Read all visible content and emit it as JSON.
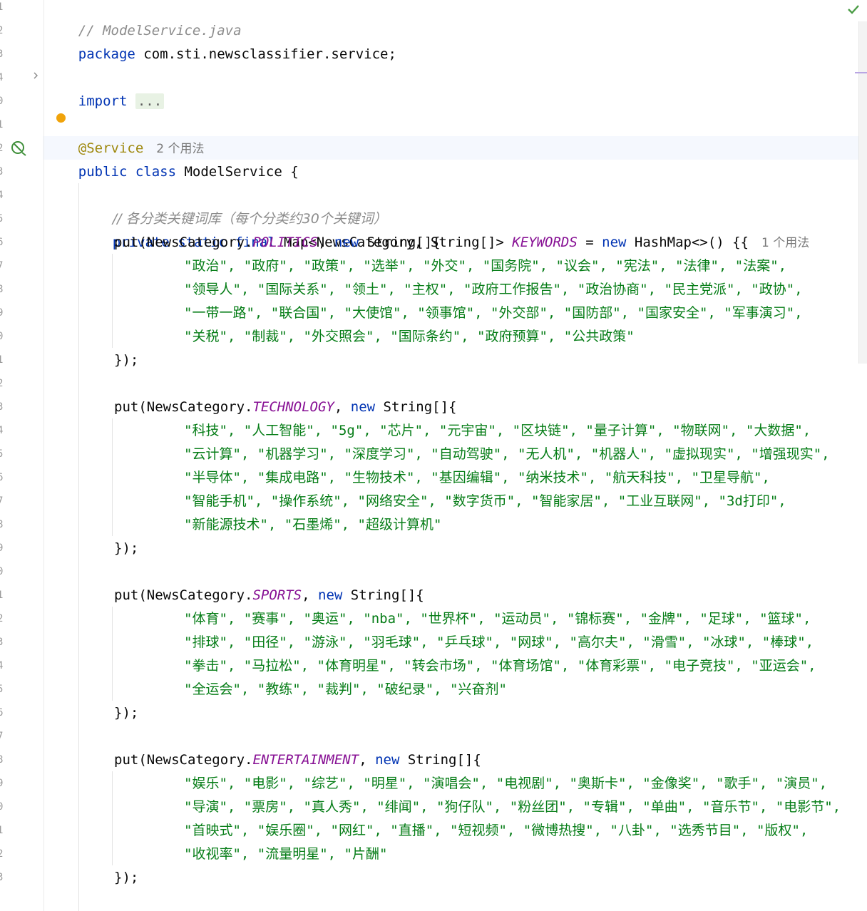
{
  "editor": {
    "line_numbers": [
      "1",
      "2",
      "3",
      "4",
      "0",
      "1",
      "2",
      "3",
      "4",
      "5",
      "6",
      "7",
      "8",
      "9",
      "0",
      "1",
      "2",
      "3",
      "4",
      "5",
      "6",
      "7",
      "8",
      "9",
      "0",
      "1",
      "2",
      "3",
      "4",
      "5",
      "6",
      "7",
      "8",
      "9",
      "0",
      "1",
      "2",
      "3"
    ],
    "usage_hints": {
      "service": "2 个用法",
      "keywords": "1 个用法"
    },
    "code": {
      "file_comment": "// ModelService.java",
      "package_kw": "package",
      "package_name": " com.sti.newsclassifier.service;",
      "import_kw": "import",
      "import_folded": "...",
      "annotation": "@Service",
      "class_decl_kw": "public class",
      "class_name": " ModelService {",
      "kw_comment": "// 各分类关键词库（每个分类约30个关键词）",
      "field_mods": "private static final",
      "field_type": " Map<NewsCategory, String[]> ",
      "field_name": "KEYWORDS",
      "field_assign": " = ",
      "new_kw": "new",
      "field_init": " HashMap<>() {{",
      "put_prefix": "put(NewsCategory.",
      "put_mid": ", ",
      "put_suffix": " String[]{",
      "block_close": "});"
    },
    "categories": [
      {
        "name": "POLITICS",
        "lines": [
          "\"政治\", \"政府\", \"政策\", \"选举\", \"外交\", \"国务院\", \"议会\", \"宪法\", \"法律\", \"法案\",",
          "\"领导人\", \"国际关系\", \"领土\", \"主权\", \"政府工作报告\", \"政治协商\", \"民主党派\", \"政协\",",
          "\"一带一路\", \"联合国\", \"大使馆\", \"领事馆\", \"外交部\", \"国防部\", \"国家安全\", \"军事演习\",",
          "\"关税\", \"制裁\", \"外交照会\", \"国际条约\", \"政府预算\", \"公共政策\""
        ]
      },
      {
        "name": "TECHNOLOGY",
        "lines": [
          "\"科技\", \"人工智能\", \"5g\", \"芯片\", \"元宇宙\", \"区块链\", \"量子计算\", \"物联网\", \"大数据\",",
          "\"云计算\", \"机器学习\", \"深度学习\", \"自动驾驶\", \"无人机\", \"机器人\", \"虚拟现实\", \"增强现实\",",
          "\"半导体\", \"集成电路\", \"生物技术\", \"基因编辑\", \"纳米技术\", \"航天科技\", \"卫星导航\",",
          "\"智能手机\", \"操作系统\", \"网络安全\", \"数字货币\", \"智能家居\", \"工业互联网\", \"3d打印\",",
          "\"新能源技术\", \"石墨烯\", \"超级计算机\""
        ]
      },
      {
        "name": "SPORTS",
        "lines": [
          "\"体育\", \"赛事\", \"奥运\", \"nba\", \"世界杯\", \"运动员\", \"锦标赛\", \"金牌\", \"足球\", \"篮球\",",
          "\"排球\", \"田径\", \"游泳\", \"羽毛球\", \"乒乓球\", \"网球\", \"高尔夫\", \"滑雪\", \"冰球\", \"棒球\",",
          "\"拳击\", \"马拉松\", \"体育明星\", \"转会市场\", \"体育场馆\", \"体育彩票\", \"电子竞技\", \"亚运会\",",
          "\"全运会\", \"教练\", \"裁判\", \"破纪录\", \"兴奋剂\""
        ]
      },
      {
        "name": "ENTERTAINMENT",
        "lines": [
          "\"娱乐\", \"电影\", \"综艺\", \"明星\", \"演唱会\", \"电视剧\", \"奥斯卡\", \"金像奖\", \"歌手\", \"演员\",",
          "\"导演\", \"票房\", \"真人秀\", \"绯闻\", \"狗仔队\", \"粉丝团\", \"专辑\", \"单曲\", \"音乐节\", \"电影节\",",
          "\"首映式\", \"娱乐圈\", \"网红\", \"直播\", \"短视频\", \"微博热搜\", \"八卦\", \"选秀节目\", \"版权\",",
          "\"收视率\", \"流量明星\", \"片酬\""
        ]
      }
    ],
    "colors": {
      "keyword": "#0033b3",
      "string": "#067d17",
      "comment": "#8c8c8c",
      "static_field": "#871094",
      "annotation": "#9e880d"
    }
  }
}
